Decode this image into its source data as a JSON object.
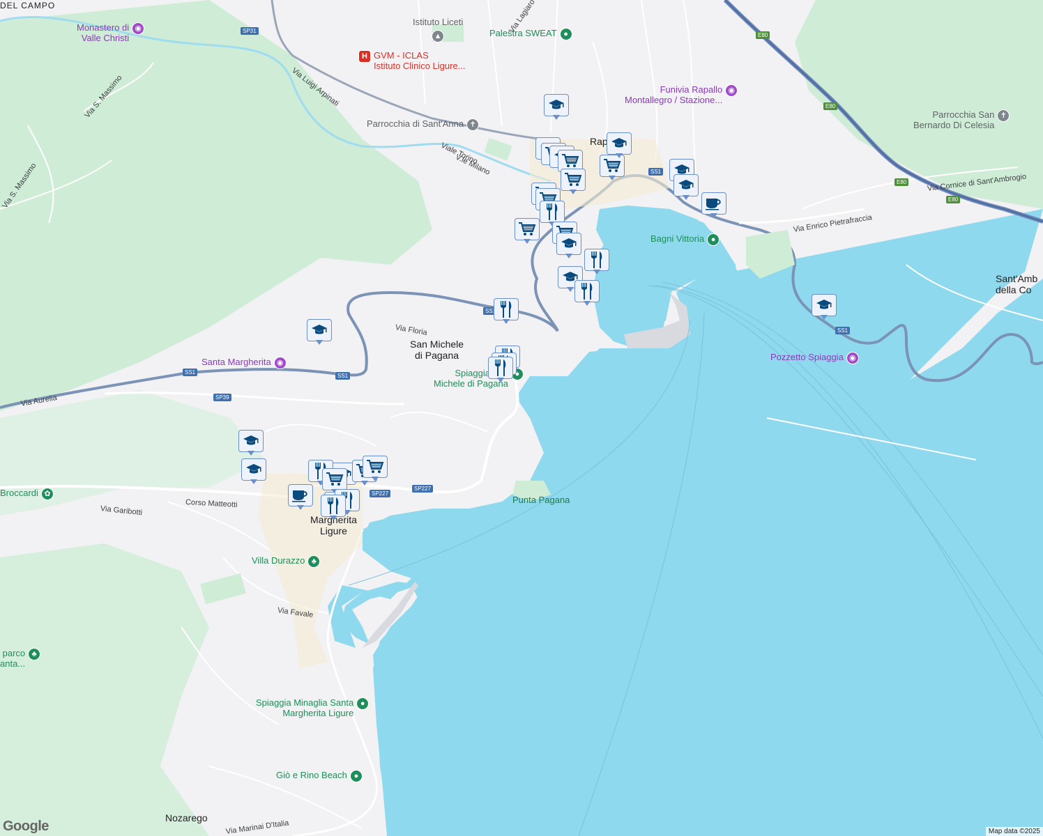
{
  "map": {
    "attribution": "Map data ©2025",
    "logo": "Google"
  },
  "towns": [
    {
      "id": "rapallo",
      "label": "Rapallo"
    },
    {
      "id": "san-michele",
      "label": "San Michele\ndi Pagana"
    },
    {
      "id": "santa-margherita",
      "label": "Santa\nMargherita\nLigure"
    },
    {
      "id": "nozarego",
      "label": "Nozarego"
    },
    {
      "id": "del-campo",
      "label": "DEL CAMPO"
    },
    {
      "id": "santambrogio",
      "label": "Sant'Amb\ndella Co"
    }
  ],
  "roads": [
    {
      "id": "luigi-arpinati",
      "label": "Via Luigi Arpinati"
    },
    {
      "id": "viale-torino",
      "label": "Viale Torino"
    },
    {
      "id": "vle-milano",
      "label": "V.le Milano"
    },
    {
      "id": "via-s-massimo-1",
      "label": "Via S. Massimo"
    },
    {
      "id": "via-s-massimo-2",
      "label": "Via S. Massimo"
    },
    {
      "id": "via-floria",
      "label": "Via Floria"
    },
    {
      "id": "via-aurelia",
      "label": "Via Aurelia"
    },
    {
      "id": "corso-matteotti",
      "label": "Corso Matteotti"
    },
    {
      "id": "via-garibotti",
      "label": "Via Garibotti"
    },
    {
      "id": "via-favale",
      "label": "Via Favale"
    },
    {
      "id": "via-marinai",
      "label": "Via Marinai D'Italia"
    },
    {
      "id": "via-pietrafraccia",
      "label": "Via Enrico Pietrafraccia"
    },
    {
      "id": "via-cornice",
      "label": "Via Cornice di Sant'Ambrogio"
    },
    {
      "id": "via-lagiaro",
      "label": "Via Lagiaro"
    },
    {
      "id": "punta-pagana",
      "label": "Punta Pagana"
    }
  ],
  "shields": [
    {
      "id": "sp31",
      "label": "SP31",
      "kind": "blue"
    },
    {
      "id": "e80-1",
      "label": "E80",
      "kind": "green"
    },
    {
      "id": "e80-2",
      "label": "E80",
      "kind": "green"
    },
    {
      "id": "e80-3",
      "label": "E80",
      "kind": "green"
    },
    {
      "id": "e80-4",
      "label": "E80",
      "kind": "green"
    },
    {
      "id": "ss1-a",
      "label": "SS1",
      "kind": "blue"
    },
    {
      "id": "ss1-b",
      "label": "SS1",
      "kind": "blue"
    },
    {
      "id": "ss1-c",
      "label": "SS1",
      "kind": "blue"
    },
    {
      "id": "ss1-d",
      "label": "SS1",
      "kind": "blue"
    },
    {
      "id": "ss1-e",
      "label": "SS1",
      "kind": "blue"
    },
    {
      "id": "sp39",
      "label": "SP39",
      "kind": "blue"
    },
    {
      "id": "sp227-a",
      "label": "SP227",
      "kind": "blue"
    },
    {
      "id": "sp227-b",
      "label": "SP227",
      "kind": "blue"
    },
    {
      "id": "ss1-f",
      "label": "SS1",
      "kind": "blue"
    }
  ],
  "pois": [
    {
      "id": "monastero",
      "label": "Monastero di\nValle Christi",
      "color": "purple",
      "icon": "camera-icon",
      "glyph": "◉"
    },
    {
      "id": "istituto-liceti",
      "label": "Istituto Liceti",
      "color": "grey",
      "icon": "school-icon",
      "glyph": "▲"
    },
    {
      "id": "palestra",
      "label": "Palestra SWEAT",
      "color": "green",
      "icon": "place-icon",
      "glyph": "●"
    },
    {
      "id": "gvm",
      "label": "GVM - ICLAS\nIstituto Clinico Ligure...",
      "color": "red",
      "icon": "hospital-icon",
      "glyph": "H"
    },
    {
      "id": "funivia",
      "label": "Funivia Rapallo\nMontallegro / Stazione...",
      "color": "purple",
      "icon": "camera-icon",
      "glyph": "◉"
    },
    {
      "id": "sant-anna",
      "label": "Parrocchia di Sant'Anna",
      "color": "grey",
      "icon": "church-icon",
      "glyph": "✝"
    },
    {
      "id": "san-bernardo",
      "label": "Parrocchia San\nBernardo Di Celesia",
      "color": "grey",
      "icon": "church-icon",
      "glyph": "✝"
    },
    {
      "id": "bagni-vittoria",
      "label": "Bagni Vittoria",
      "color": "green",
      "icon": "place-icon",
      "glyph": "●"
    },
    {
      "id": "pozzetto",
      "label": "Pozzetto Spiaggia",
      "color": "purple",
      "icon": "camera-icon",
      "glyph": "◉"
    },
    {
      "id": "santa-margherita-poi",
      "label": "Santa Margherita",
      "color": "purple",
      "icon": "camera-icon",
      "glyph": "◉"
    },
    {
      "id": "spiaggia-smp",
      "label": "Spiaggia di S\nMichele di Pagana",
      "color": "green",
      "icon": "place-icon",
      "glyph": "●"
    },
    {
      "id": "broccardi",
      "label": "Broccardi",
      "color": "green",
      "icon": "park-icon",
      "glyph": "✿"
    },
    {
      "id": "villa-durazzo",
      "label": "Villa Durazzo",
      "color": "green",
      "icon": "tree-icon",
      "glyph": "♣"
    },
    {
      "id": "parco-santa",
      "label": "parco\nanta...",
      "color": "green",
      "icon": "tree-icon",
      "glyph": "♣"
    },
    {
      "id": "spiaggia-minaglia",
      "label": "Spiaggia Minaglia Santa\nMargherita Ligure",
      "color": "green",
      "icon": "place-icon",
      "glyph": "●"
    },
    {
      "id": "gio-rino",
      "label": "Giò e Rino Beach",
      "color": "green",
      "icon": "place-icon",
      "glyph": "●"
    }
  ],
  "markers": [
    {
      "type": "school"
    },
    {
      "type": "school"
    },
    {
      "type": "shop"
    },
    {
      "type": "school"
    },
    {
      "type": "shop"
    },
    {
      "type": "shop"
    },
    {
      "type": "shop"
    },
    {
      "type": "school"
    },
    {
      "type": "school"
    },
    {
      "type": "school"
    },
    {
      "type": "shop"
    },
    {
      "type": "shop"
    },
    {
      "type": "food"
    },
    {
      "type": "cafe"
    },
    {
      "type": "shop"
    },
    {
      "type": "shop"
    },
    {
      "type": "school"
    },
    {
      "type": "food"
    },
    {
      "type": "school"
    },
    {
      "type": "food"
    },
    {
      "type": "food"
    },
    {
      "type": "school"
    },
    {
      "type": "school"
    },
    {
      "type": "food"
    },
    {
      "type": "food"
    },
    {
      "type": "food"
    },
    {
      "type": "school"
    },
    {
      "type": "school"
    },
    {
      "type": "food"
    },
    {
      "type": "shop"
    },
    {
      "type": "shop"
    },
    {
      "type": "shop"
    },
    {
      "type": "cafe"
    },
    {
      "type": "food"
    },
    {
      "type": "food"
    },
    {
      "type": "food"
    },
    {
      "type": "school"
    }
  ]
}
